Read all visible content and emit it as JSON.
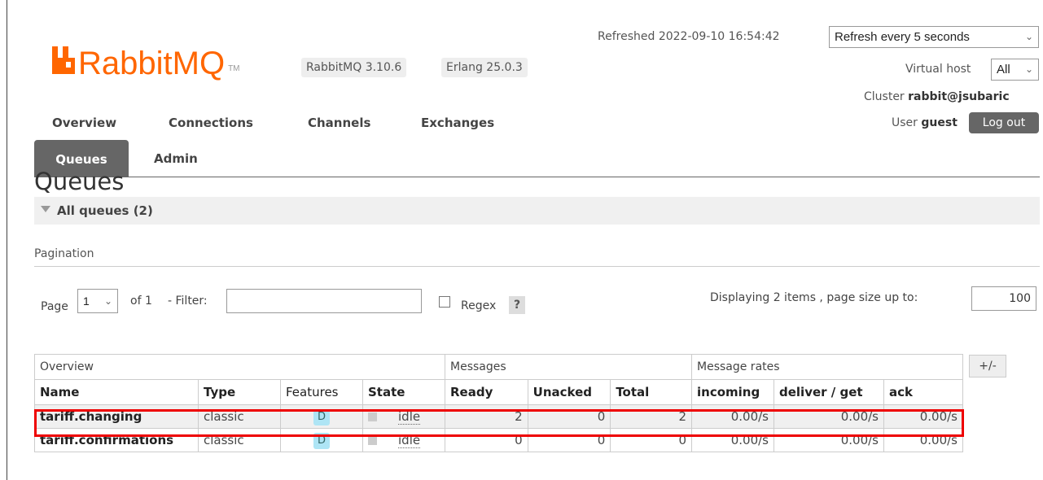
{
  "logo": {
    "text": "RabbitMQ",
    "tm": "TM"
  },
  "versions": {
    "rabbitmq": "RabbitMQ 3.10.6",
    "erlang": "Erlang 25.0.3"
  },
  "header": {
    "refreshed": "Refreshed 2022-09-10 16:54:42",
    "refresh_select": "Refresh every 5 seconds",
    "vhost_label": "Virtual host",
    "vhost_select": "All",
    "cluster_label": "Cluster",
    "cluster_value": "rabbit@jsubaric",
    "user_label": "User",
    "user_value": "guest",
    "logout": "Log out"
  },
  "nav": {
    "overview": "Overview",
    "connections": "Connections",
    "channels": "Channels",
    "exchanges": "Exchanges",
    "queues": "Queues",
    "admin": "Admin"
  },
  "page": {
    "title": "Queues",
    "section": "All queues (2)",
    "pagination_label": "Pagination"
  },
  "pagination": {
    "page_label": "Page",
    "page_value": "1",
    "of": "of 1",
    "filter_label": "- Filter:",
    "filter_value": "",
    "regex_label": "Regex",
    "help": "?",
    "displaying": "Displaying 2 items , page size up to:",
    "page_size": "100"
  },
  "table": {
    "groups": [
      "Overview",
      "Messages",
      "Message rates"
    ],
    "headers": [
      "Name",
      "Type",
      "Features",
      "State",
      "Ready",
      "Unacked",
      "Total",
      "incoming",
      "deliver / get",
      "ack"
    ],
    "toggle": "+/-",
    "rows": [
      {
        "name": "tariff.changing",
        "type": "classic",
        "features": "D",
        "state": "idle",
        "ready": "2",
        "unacked": "0",
        "total": "2",
        "incoming": "0.00/s",
        "deliver": "0.00/s",
        "ack": "0.00/s"
      },
      {
        "name": "tariff.confirmations",
        "type": "classic",
        "features": "D",
        "state": "idle",
        "ready": "0",
        "unacked": "0",
        "total": "0",
        "incoming": "0.00/s",
        "deliver": "0.00/s",
        "ack": "0.00/s"
      }
    ]
  },
  "colors": {
    "brand": "#ff6600",
    "highlight": "#ee0000",
    "tab_active": "#666666"
  }
}
